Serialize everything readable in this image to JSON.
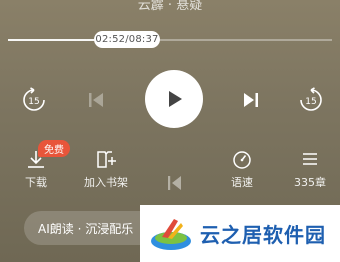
{
  "header": {
    "title": "云霹 · 悬疑"
  },
  "progress": {
    "time_label": "02:52/08:37",
    "fraction": 0.333
  },
  "controls": {
    "rewind_label": "15",
    "forward_label": "15"
  },
  "toolbar": {
    "badge": "免费",
    "items": [
      {
        "label": "下载",
        "icon": "download-icon"
      },
      {
        "label": "加入书架",
        "icon": "bookshelf-add-icon"
      },
      {
        "label": "语速",
        "icon": "speed-icon"
      },
      {
        "label": "335章",
        "icon": "chapter-list-icon"
      }
    ]
  },
  "ai_read": {
    "label": "AI朗读 · 沉浸配乐"
  },
  "watermark": {
    "text": "云之居软件园"
  },
  "colors": {
    "accent_badge": "#e8553a",
    "watermark_blue": "#1e5fb0"
  }
}
